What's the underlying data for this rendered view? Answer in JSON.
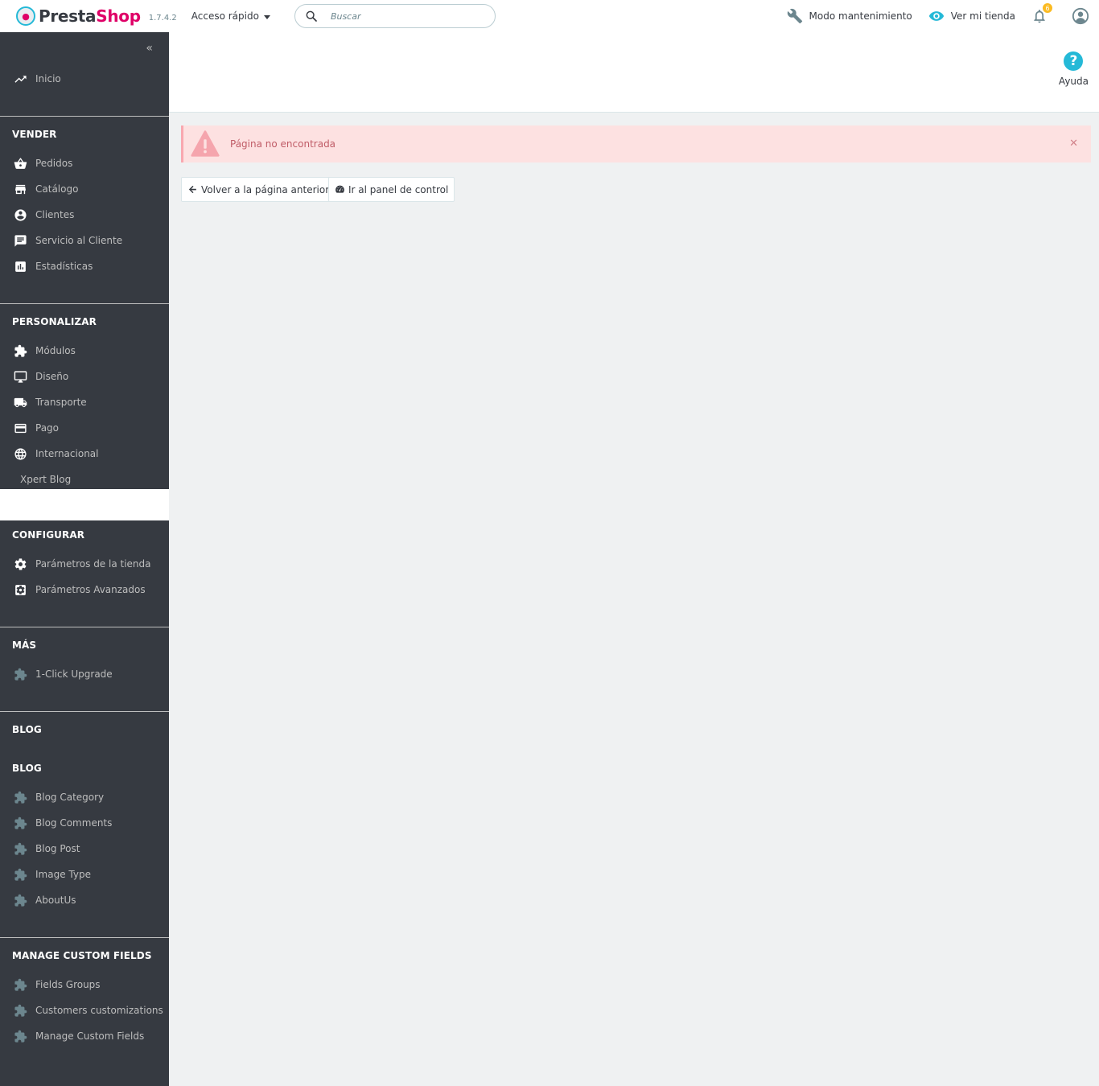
{
  "header": {
    "brand_first": "Presta",
    "brand_second": "Shop",
    "version": "1.7.4.2",
    "quick_access": "Acceso rápido",
    "search_placeholder": "Buscar",
    "maintenance": "Modo mantenimiento",
    "view_store": "Ver mi tienda",
    "notifications_count": "6"
  },
  "sidebar": {
    "home": "Inicio",
    "sections": {
      "sell": "VENDER",
      "customize": "PERSONALIZAR",
      "configure": "CONFIGURAR",
      "more": "MÁS",
      "blog": "BLOG",
      "blog2": "BLOG",
      "custom_fields": "MANAGE CUSTOM FIELDS"
    },
    "sell_items": [
      "Pedidos",
      "Catálogo",
      "Clientes",
      "Servicio al Cliente",
      "Estadísticas"
    ],
    "customize_items": [
      "Módulos",
      "Diseño",
      "Transporte",
      "Pago",
      "Internacional",
      "Xpert Blog"
    ],
    "configure_items": [
      "Parámetros de la tienda",
      "Parámetros Avanzados"
    ],
    "more_items": [
      "1-Click Upgrade"
    ],
    "blog_items": [
      "Blog Category",
      "Blog Comments",
      "Blog Post",
      "Image Type",
      "AboutUs"
    ],
    "custom_field_items": [
      "Fields Groups",
      "Customers customizations",
      "Manage Custom Fields"
    ]
  },
  "page": {
    "help": "Ayuda",
    "alert": "Página no encontrada",
    "back_button": "Volver a la página anterior",
    "dashboard_button": "Ir al panel de control"
  },
  "colors": {
    "accent": "#25b9d7",
    "brand": "#df0067",
    "sidebar_bg": "#363a41",
    "alert_bg": "#fde1e1",
    "alert_text": "#c05c67"
  }
}
